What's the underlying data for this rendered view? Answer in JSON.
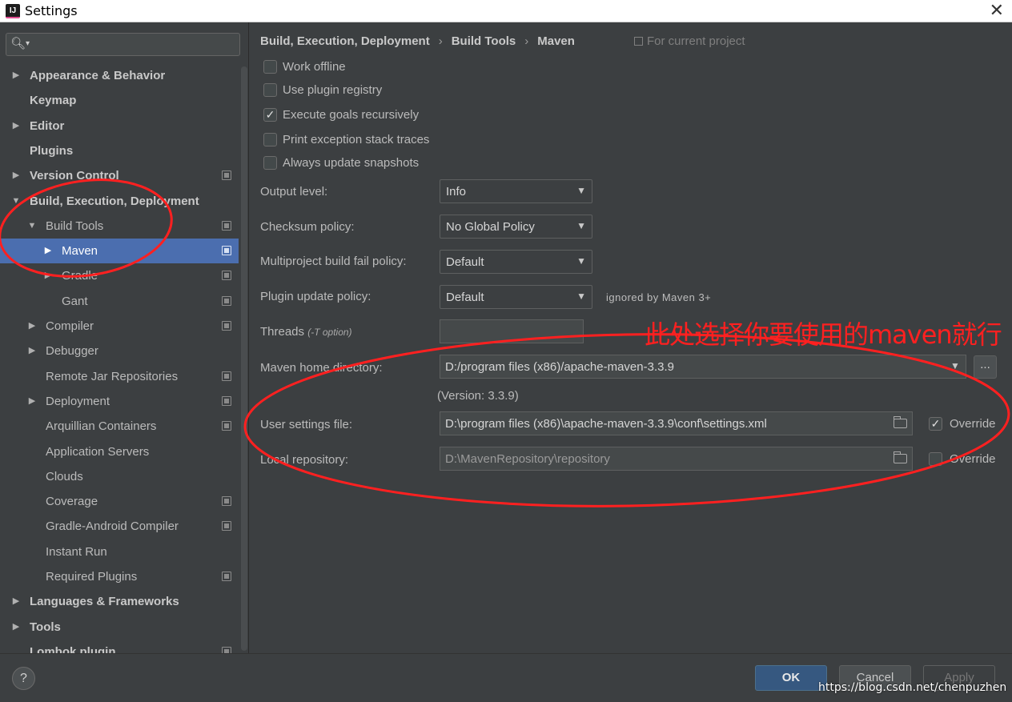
{
  "window": {
    "title": "Settings",
    "close_glyph": "✕",
    "app_icon_label": "IJ"
  },
  "search": {
    "placeholder": ""
  },
  "sidebar": {
    "items": [
      {
        "label": "Appearance & Behavior",
        "arrow": "▶",
        "bold": true,
        "project": false
      },
      {
        "label": "Keymap",
        "arrow": "",
        "bold": true,
        "project": false
      },
      {
        "label": "Editor",
        "arrow": "▶",
        "bold": true,
        "project": false
      },
      {
        "label": "Plugins",
        "arrow": "",
        "bold": true,
        "project": false
      },
      {
        "label": "Version Control",
        "arrow": "▶",
        "bold": true,
        "project": true
      },
      {
        "label": "Build, Execution, Deployment",
        "arrow": "▼",
        "bold": true,
        "project": false
      },
      {
        "label": "Build Tools",
        "arrow": "▼",
        "bold": false,
        "project": true
      },
      {
        "label": "Maven",
        "arrow": "▶",
        "bold": false,
        "project": true,
        "selected": true
      },
      {
        "label": "Gradle",
        "arrow": "▶",
        "bold": false,
        "project": true
      },
      {
        "label": "Gant",
        "arrow": "",
        "bold": false,
        "project": true
      },
      {
        "label": "Compiler",
        "arrow": "▶",
        "bold": false,
        "project": true
      },
      {
        "label": "Debugger",
        "arrow": "▶",
        "bold": false,
        "project": false
      },
      {
        "label": "Remote Jar Repositories",
        "arrow": "",
        "bold": false,
        "project": true
      },
      {
        "label": "Deployment",
        "arrow": "▶",
        "bold": false,
        "project": true
      },
      {
        "label": "Arquillian Containers",
        "arrow": "",
        "bold": false,
        "project": true
      },
      {
        "label": "Application Servers",
        "arrow": "",
        "bold": false,
        "project": false
      },
      {
        "label": "Clouds",
        "arrow": "",
        "bold": false,
        "project": false
      },
      {
        "label": "Coverage",
        "arrow": "",
        "bold": false,
        "project": true
      },
      {
        "label": "Gradle-Android Compiler",
        "arrow": "",
        "bold": false,
        "project": true
      },
      {
        "label": "Instant Run",
        "arrow": "",
        "bold": false,
        "project": false
      },
      {
        "label": "Required Plugins",
        "arrow": "",
        "bold": false,
        "project": true
      },
      {
        "label": "Languages & Frameworks",
        "arrow": "▶",
        "bold": true,
        "project": false
      },
      {
        "label": "Tools",
        "arrow": "▶",
        "bold": true,
        "project": false
      },
      {
        "label": "Lombok plugin",
        "arrow": "",
        "bold": true,
        "project": true
      }
    ]
  },
  "breadcrumb": {
    "parts": [
      "Build, Execution, Deployment",
      "Build Tools",
      "Maven"
    ],
    "separator": "›",
    "for_project": "For current project"
  },
  "checkboxes": [
    {
      "label": "Work offline",
      "checked": false
    },
    {
      "label": "Use plugin registry",
      "checked": false
    },
    {
      "label": "Execute goals recursively",
      "checked": true
    },
    {
      "label": "Print exception stack traces",
      "checked": false
    },
    {
      "label": "Always update snapshots",
      "checked": false
    }
  ],
  "fields": {
    "output_level": {
      "label": "Output level:",
      "value": "Info"
    },
    "checksum_policy": {
      "label": "Checksum policy:",
      "value": "No Global Policy"
    },
    "fail_policy": {
      "label": "Multiproject build fail policy:",
      "value": "Default"
    },
    "update_policy": {
      "label": "Plugin update policy:",
      "value": "Default",
      "note": "ignored by Maven 3+"
    },
    "threads": {
      "label": "Threads",
      "hint": "(-T option)",
      "value": ""
    },
    "maven_home": {
      "label": "Maven home directory:",
      "value": "D:/program files (x86)/apache-maven-3.3.9",
      "version": "(Version: 3.3.9)",
      "browse": "..."
    },
    "user_settings": {
      "label": "User settings file:",
      "value": "D:\\program files (x86)\\apache-maven-3.3.9\\conf\\settings.xml",
      "override_label": "Override",
      "override_checked": true
    },
    "local_repo": {
      "label": "Local repository:",
      "value": "D:\\MavenRepository\\repository",
      "override_label": "Override",
      "override_checked": false
    }
  },
  "annotation": {
    "text": "此处选择你要使用的maven就行",
    "color": "#ff2020"
  },
  "footer": {
    "help": "?",
    "ok": "OK",
    "cancel": "Cancel",
    "apply": "Apply",
    "watermark": "https://blog.csdn.net/chenpuzhen"
  },
  "colors": {
    "selection": "#4b6eaf",
    "background": "#3c3f41",
    "ok_button": "#365880"
  }
}
